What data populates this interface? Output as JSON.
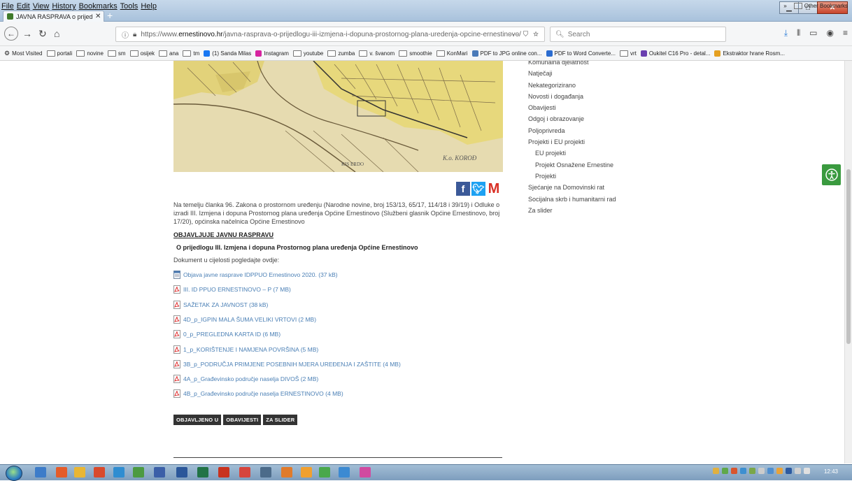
{
  "window": {
    "menu": [
      "File",
      "Edit",
      "View",
      "History",
      "Bookmarks",
      "Tools",
      "Help"
    ],
    "tab_title": "JAVNA RASPRAVA o prijedlogu",
    "tab_close": "✕",
    "new_tab": "+"
  },
  "nav": {
    "url_prefix": "https://www.",
    "url_host": "ernestinovo.hr",
    "url_path": "/javna-rasprava-o-prijedlogu-iii-izmjena-i-dopuna-prostornog-plana-uredenja-opcine-ernestinovo/",
    "url_actions": "··· ⛉ ☆",
    "search_placeholder": "Search"
  },
  "bookmarks": [
    {
      "label": "Most Visited",
      "icon": "gear-icon"
    },
    {
      "label": "portali",
      "icon": "folder-icon"
    },
    {
      "label": "novine",
      "icon": "folder-icon"
    },
    {
      "label": "sm",
      "icon": "folder-icon"
    },
    {
      "label": "osijek",
      "icon": "folder-icon"
    },
    {
      "label": "ana",
      "icon": "folder-icon"
    },
    {
      "label": "tm",
      "icon": "folder-icon"
    },
    {
      "label": "(1) Sanda Milas",
      "icon": "facebook-icon"
    },
    {
      "label": "Instagram",
      "icon": "instagram-icon"
    },
    {
      "label": "youtube",
      "icon": "folder-icon"
    },
    {
      "label": "zumba",
      "icon": "folder-icon"
    },
    {
      "label": "v. švanom",
      "icon": "folder-icon"
    },
    {
      "label": "smoothie",
      "icon": "folder-icon"
    },
    {
      "label": "KonMari",
      "icon": "folder-icon"
    },
    {
      "label": "PDF to JPG online con...",
      "icon": "pdf-jpg-icon"
    },
    {
      "label": "PDF to Word Converte...",
      "icon": "pdf-word-icon"
    },
    {
      "label": "vrt",
      "icon": "folder-icon"
    },
    {
      "label": "Oukitel C16 Pro - detal...",
      "icon": "shop-icon"
    },
    {
      "label": "Ekstraktor hrane Rosm...",
      "icon": "v-icon"
    }
  ],
  "bookmarks_other": "Other Bookmarks",
  "article": {
    "map_label": "K.o. KOROĐ",
    "intro": "Na temelju članka 96. Zakona o prostornom uređenju (Narodne novine, broj 153/13, 65/17, 114/18 i 39/19) i Odluke o izradi III. Izmjena i dopuna Prostornog plana uređenja Općine Ernestinovo (Službeni glasnik Općine Ernestinovo, broj 17/20), općinska načelnica Općine Ernestinovo",
    "objavljuje": "OBJAVLJUJE JAVNU RASPRAVU",
    "subject": "O prijedlogu III. Izmjena i dopuna Prostornog plana uređenja Općine Ernestinovo",
    "doc_intro": "Dokument u cijelosti pogledajte ovdje:",
    "documents": [
      {
        "label": "Objava javne rasprave IDPPUO Ernestinovo 2020. (37 kB)",
        "icon": "calendar-doc-icon"
      },
      {
        "label": "III. ID PPUO ERNESTINOVO – P (7 MB)",
        "icon": "pdf-icon"
      },
      {
        "label": "SAŽETAK ZA JAVNOST (38 kB)",
        "icon": "pdf-icon"
      },
      {
        "label": "4D_p_IGPIN MALA ŠUMA VELIKI VRTOVI (2 MB)",
        "icon": "pdf-icon"
      },
      {
        "label": "0_p_PREGLEDNA KARTA ID (6 MB)",
        "icon": "pdf-icon"
      },
      {
        "label": "1_p_KORIŠTENJE I NAMJENA POVRŠINA (5 MB)",
        "icon": "pdf-icon"
      },
      {
        "label": "3B_p_PODRUČJA PRIMJENE POSEBNIH MJERA UREĐENJA I ZAŠTITE (4 MB)",
        "icon": "pdf-icon"
      },
      {
        "label": "4A_p_Građevinsko područje naselja DIVOŠ (2 MB)",
        "icon": "pdf-icon"
      },
      {
        "label": "4B_p_Građevinsko područje naselja ERNESTINOVO (4 MB)",
        "icon": "pdf-icon"
      }
    ],
    "tags": [
      "OBJAVLJENO U",
      "OBAVIJESTI",
      "ZA SLIDER"
    ]
  },
  "sidebar": {
    "categories": [
      {
        "label": "Komunalna djelatnost",
        "sub": false
      },
      {
        "label": "Natječaji",
        "sub": false
      },
      {
        "label": "Nekategorizirano",
        "sub": false
      },
      {
        "label": "Novosti i događanja",
        "sub": false
      },
      {
        "label": "Obavijesti",
        "sub": false
      },
      {
        "label": "Odgoj i obrazovanje",
        "sub": false
      },
      {
        "label": "Poljoprivreda",
        "sub": false
      },
      {
        "label": "Projekti i EU projekti",
        "sub": false
      },
      {
        "label": "EU projekti",
        "sub": true
      },
      {
        "label": "Projekt Osnažene Ernestine",
        "sub": true
      },
      {
        "label": "Projekti",
        "sub": true
      },
      {
        "label": "Sjećanje na Domovinski rat",
        "sub": false
      },
      {
        "label": "Socijalna skrb i humanitarni rad",
        "sub": false
      },
      {
        "label": "Za slider",
        "sub": false
      }
    ]
  },
  "taskbar": {
    "clock": "12:43"
  },
  "colors": {
    "link": "#4a7fb5",
    "accessibility_green": "#3a9a3f",
    "tag_bg": "#333333"
  }
}
